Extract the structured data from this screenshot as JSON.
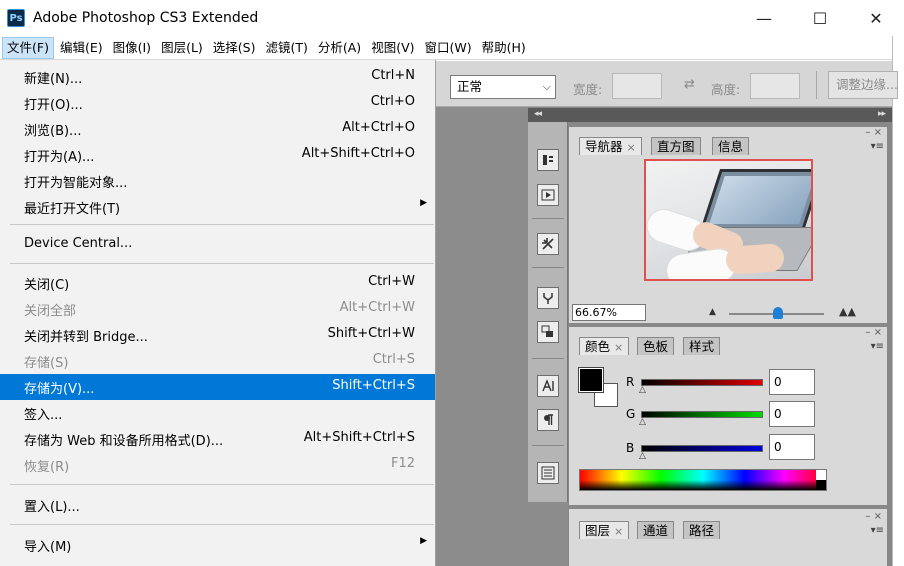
{
  "window": {
    "title": "Adobe Photoshop CS3 Extended",
    "logo_text": "Ps",
    "minimize": "—",
    "maximize": "☐",
    "close": "✕"
  },
  "menubar": [
    "文件(F)",
    "编辑(E)",
    "图像(I)",
    "图层(L)",
    "选择(S)",
    "滤镜(T)",
    "分析(A)",
    "视图(V)",
    "窗口(W)",
    "帮助(H)"
  ],
  "file_menu": {
    "items": [
      {
        "label": "新建(N)...",
        "shortcut": "Ctrl+N"
      },
      {
        "label": "打开(O)...",
        "shortcut": "Ctrl+O"
      },
      {
        "label": "浏览(B)...",
        "shortcut": "Alt+Ctrl+O"
      },
      {
        "label": "打开为(A)...",
        "shortcut": "Alt+Shift+Ctrl+O"
      },
      {
        "label": "打开为智能对象...",
        "shortcut": ""
      },
      {
        "label": "最近打开文件(T)",
        "shortcut": ""
      },
      {
        "label": "Device Central...",
        "shortcut": ""
      },
      {
        "label": "关闭(C)",
        "shortcut": "Ctrl+W"
      },
      {
        "label": "关闭全部",
        "shortcut": "Alt+Ctrl+W"
      },
      {
        "label": "关闭并转到 Bridge...",
        "shortcut": "Shift+Ctrl+W"
      },
      {
        "label": "存储(S)",
        "shortcut": "Ctrl+S"
      },
      {
        "label": "存储为(V)...",
        "shortcut": "Shift+Ctrl+S"
      },
      {
        "label": "签入...",
        "shortcut": ""
      },
      {
        "label": "存储为 Web 和设备所用格式(D)...",
        "shortcut": "Alt+Shift+Ctrl+S"
      },
      {
        "label": "恢复(R)",
        "shortcut": "F12"
      },
      {
        "label": "置入(L)...",
        "shortcut": ""
      },
      {
        "label": "导入(M)",
        "shortcut": ""
      }
    ]
  },
  "options_bar": {
    "mode": "正常",
    "width_label": "宽度:",
    "height_label": "高度:",
    "swap_icon": "⇄",
    "adjust_edge": "调整边缘..."
  },
  "navigator": {
    "tabs": [
      "导航器",
      "直方图",
      "信息"
    ],
    "zoom": "66.67%"
  },
  "color_panel": {
    "tabs": [
      "颜色",
      "色板",
      "样式"
    ],
    "channels": [
      {
        "name": "R",
        "value": "0"
      },
      {
        "name": "G",
        "value": "0"
      },
      {
        "name": "B",
        "value": "0"
      }
    ],
    "colors": {
      "foreground": "#000000",
      "background": "#ffffff"
    }
  },
  "layers_panel": {
    "tabs": [
      "图层",
      "通道",
      "路径"
    ]
  },
  "icons": {
    "tab_close": "×",
    "panel_min": "–",
    "panel_close": "×",
    "panel_menu": "▾≡",
    "submenu_arrow": "▶",
    "dropdown_chev": "⌵",
    "dock_collapse": "◂◂",
    "dock_expand": "▸▸",
    "tools": [
      "history-brush-icon",
      "actions-play-icon",
      "tool-presets-icon",
      "brushes-icon",
      "clone-source-icon",
      "character-icon",
      "paragraph-icon",
      "layer-comps-icon"
    ]
  }
}
